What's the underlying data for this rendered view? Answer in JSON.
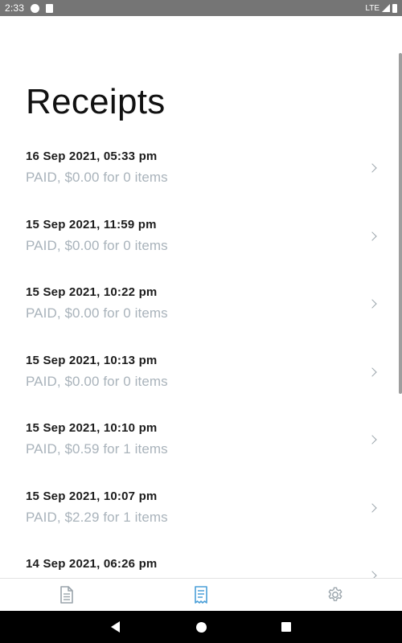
{
  "status_bar": {
    "time": "2:33",
    "network": "LTE"
  },
  "page": {
    "title": "Receipts"
  },
  "receipts": [
    {
      "date": "16 Sep 2021, 05:33 pm",
      "summary": "PAID, $0.00 for 0 items"
    },
    {
      "date": "15 Sep 2021, 11:59 pm",
      "summary": "PAID, $0.00 for 0 items"
    },
    {
      "date": "15 Sep 2021, 10:22 pm",
      "summary": "PAID, $0.00 for 0 items"
    },
    {
      "date": "15 Sep 2021, 10:13 pm",
      "summary": "PAID, $0.00 for 0 items"
    },
    {
      "date": "15 Sep 2021, 10:10 pm",
      "summary": "PAID, $0.59 for 1 items"
    },
    {
      "date": "15 Sep 2021, 10:07 pm",
      "summary": "PAID, $2.29 for 1 items"
    },
    {
      "date": "14 Sep 2021, 06:26 pm",
      "summary": ""
    }
  ],
  "bottom_nav": {
    "items": [
      {
        "icon": "document-icon",
        "active": false
      },
      {
        "icon": "receipt-icon",
        "active": true
      },
      {
        "icon": "gear-icon",
        "active": false
      }
    ]
  },
  "colors": {
    "accent": "#4a9fd8",
    "inactive_icon": "#9aa4ab",
    "summary_text": "#a9b3bb"
  }
}
